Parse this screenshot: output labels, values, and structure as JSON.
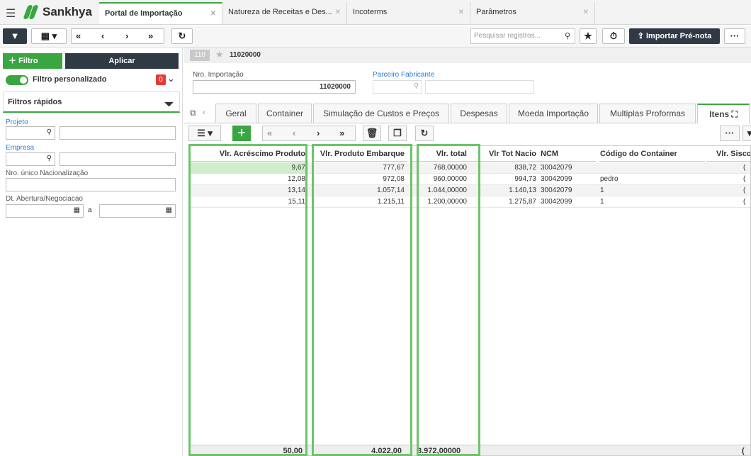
{
  "topbar": {
    "logo_text": "Sankhya",
    "tabs": [
      {
        "label": "Portal de Importação"
      },
      {
        "label": "Natureza de Receitas e Des..."
      },
      {
        "label": "Incoterms"
      },
      {
        "label": "Parâmetros"
      }
    ]
  },
  "toolbar": {
    "search_placeholder": "Pesquisar registros...",
    "import_label": "Importar Pré-nota",
    "more_label": "···"
  },
  "sidebar": {
    "filtro_label": "Filtro",
    "aplicar_label": "Aplicar",
    "custom_filter_label": "Filtro personalizado",
    "custom_filter_count": "0",
    "quick_filters_title": "Filtros rápidos",
    "fields": {
      "projeto": "Projeto",
      "empresa": "Empresa",
      "nro_nacionalizacao": "Nro. único Nacionalização",
      "dt_abertura": "Dt. Abertura/Negociacao",
      "range_sep": "a"
    }
  },
  "record": {
    "badge": "110",
    "id": "11020000",
    "nro_importacao_label": "Nro. Importação",
    "nro_importacao_value": "11020000",
    "parceiro_label": "Parceiro Fabricante"
  },
  "detail_tabs": [
    {
      "label": "Geral"
    },
    {
      "label": "Container"
    },
    {
      "label": "Simulação de Custos e Preços"
    },
    {
      "label": "Despesas"
    },
    {
      "label": "Moeda Importação"
    },
    {
      "label": "Multiplas Proformas"
    },
    {
      "label": "Itens ⛶"
    }
  ],
  "grid": {
    "columns": [
      {
        "label": "Vlr. Acréscimo Produto"
      },
      {
        "label": "Vlr. Produto Embarque"
      },
      {
        "label": "Vlr. total"
      },
      {
        "label": "Vlr Tot Nacio"
      },
      {
        "label": "NCM"
      },
      {
        "label": "Código do Container"
      },
      {
        "label": "Vlr. Siscor"
      }
    ],
    "rows": [
      [
        "9,67",
        "777,67",
        "768,00000",
        "838,72",
        "30042079",
        "",
        "("
      ],
      [
        "12,08",
        "972,08",
        "960,00000",
        "994,73",
        "30042099",
        "pedro",
        "("
      ],
      [
        "13,14",
        "1.057,14",
        "1.044,00000",
        "1.140,13",
        "30042079",
        "1",
        "("
      ],
      [
        "15,11",
        "1.215,11",
        "1.200,00000",
        "1.275,87",
        "30042099",
        "1",
        "("
      ]
    ],
    "totals": [
      "50,00",
      "4.022,00",
      "3.972,00000",
      "",
      "",
      "",
      "("
    ]
  },
  "colors": {
    "accent": "#3aa641",
    "dark": "#2f3a45",
    "highlight": "#6cc46a",
    "badge": "#e53935"
  }
}
